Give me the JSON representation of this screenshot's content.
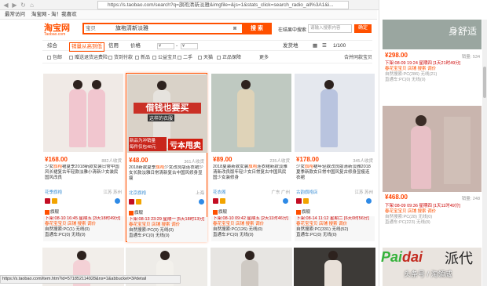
{
  "browser": {
    "url": "https://s.taobao.com/search?q=旗袍清新淡雅&imgfile=&js=1&stats_click=search_radio_all%3A1&i...",
    "bookmarks": [
      "最常访问",
      "淘宝网 - 淘！我喜欢"
    ]
  },
  "header": {
    "logo": "淘宝网",
    "logo_sub": "Taobao.com",
    "scope": "宝贝",
    "query": "旗袍清新淡雅",
    "search_button": "搜 索",
    "sub_label": "在结果中搜索",
    "sub_placeholder": "请输入搜索内容",
    "sub_button": "确定"
  },
  "sortbar": {
    "items": [
      "综合",
      "销量从高到低",
      "信用",
      "价格"
    ],
    "price_from": "¥",
    "price_to": "¥",
    "ship": "发货地",
    "view_grid": "▦",
    "view_list": "☰",
    "page": "1/100"
  },
  "filterbar": {
    "items": [
      "包邮",
      "赠送退货运费险",
      "货到付款",
      "新品",
      "公益宝贝",
      "二手",
      "天猫",
      "正品保障"
    ],
    "more": "更多",
    "combine": "合并同款宝贝"
  },
  "cards": [
    {
      "price": "¥168.00",
      "sold": "882人收货",
      "title_pre": "少女",
      "title_hl": "旗袍",
      "title_rest": "裙夏季2018新款女装日常中国风长裙复古年轻款淡雅小清新少女装民国风改良",
      "shop": "花季旗袍",
      "loc": "江苏 苏州",
      "tm": "旗舰",
      "ext_time": "下架:08-10 16:45 星期五 [3天18时49分]",
      "ext_shop": "春花宝宝贝 店铺 搜索 调价",
      "ext_stat": "自然搜索:PC(1) 无线(0)",
      "ext_car": "直通车:PC(0) 无线(0)",
      "img_bg": "#f0eae6",
      "dress": "#f1c6cf",
      "highlight": false
    },
    {
      "price": "¥48.00",
      "sold": "361人收货",
      "title_pre": "2018新款夏季",
      "title_hl": "旗袍",
      "title_rest": "少女改良版连衣裙少女长款淡雅日常清新复古中国风修身显瘦",
      "shop": "北京旗袍",
      "loc": "上海",
      "tm": "旗舰",
      "ext_time": "下架:08-13 23:29 星期一 [5天18时13分]",
      "ext_shop": "春花宝宝贝 店铺 搜索 调价",
      "ext_stat": "自然搜索:PC(0) 无线(0)",
      "ext_car": "直通车:PC(0) 无线(0)",
      "img_bg": "#d9d2c8",
      "dress": "#e6e3de",
      "highlight": true,
      "promo1": "借钱也要买",
      "promo2": "这样的衣服",
      "promo3": "新品为冲销量",
      "promo4": "每件仅包48元",
      "promo5": "亏本甩卖"
    },
    {
      "price": "¥89.00",
      "sold": "235人收货",
      "title_pre": "2018夏装新款女装",
      "title_hl": "旗袍",
      "title_rest": "连衣裙新款淡雅清新改良版年轻少女日常复古中国风民国少女装修身",
      "shop": "花衣阁",
      "loc": "广东 广州",
      "tm": "旗舰",
      "ext_time": "下架:08-10 09:42 星期五 [2天11时46分]",
      "ext_shop": "春花宝宝贝 店铺 搜索 调价",
      "ext_stat": "自然搜索:PC(126) 无线(0)",
      "ext_car": "直通车:PC(0) 无线(0)",
      "img_bg": "#bfc9c1",
      "dress": "#dfd3b8",
      "highlight": false
    },
    {
      "price": "¥178.00",
      "sold": "345人收货",
      "title_pre": "少女",
      "title_hl": "旗袍",
      "title_rest": "裙年轻款改良版清新淡雅2018夏季新款女日常中国风复古修身显瘦连衣裙",
      "shop": "古韵旗袍店",
      "loc": "江苏 苏州",
      "tm": "旗舰",
      "ext_time": "下架:08-14 11:12 星期二 [6天0时56分]",
      "ext_shop": "春花宝宝贝 店铺 搜索 调价",
      "ext_stat": "自然搜索:PC(331) 无线(52)",
      "ext_car": "直通车:PC(0) 无线(0)",
      "img_bg": "#e5e8ee",
      "dress": "#b9c4df",
      "highlight": false
    }
  ],
  "right_col": [
    {
      "price": "¥298.00",
      "sold": "销量: 534",
      "ext_time": "下架:08-09 19:24 星期四 [1天21时49分]",
      "ext_shop": "春花宝宝贝 店铺 搜索 调价",
      "ext_stat": "自然搜索:PC(286) 无线(21)",
      "ext_car": "直通车:PC(0) 无线(0)",
      "img_bg": "#9aa6a0",
      "banner": "身舒适"
    },
    {
      "price": "¥468.00",
      "sold": "销量: 248",
      "ext_time": "下架:08-09 09:36 星期四 [1天11时49分]",
      "ext_shop": "春花宝宝贝 店铺 搜索 调价",
      "ext_stat": "自然搜索:PC(28) 无线(0)",
      "ext_car": "直通车:PC(223) 无线(8)",
      "img_bg": "#c9b5ae",
      "dress": "#e8c0c6"
    }
  ],
  "bottom_row": [
    {
      "bg": "#f2eeea",
      "dress": "#f4d1d6"
    },
    {
      "bg": "#eeece8",
      "dress": "#f3f1ec"
    },
    {
      "bg": "#e7e5e2",
      "dress": "#cfcac4"
    },
    {
      "bg": "#3d3a37",
      "dress": "#e8e0d8"
    }
  ],
  "status_url": "https://s.taobao.com/item.htm?id=571852114928&ns=1&abbucket=3#detail",
  "watermark": {
    "brand1": "Pai",
    "brand2": "dai",
    "brand_cn": "派代",
    "caption": "头条号 / 淘領威"
  },
  "colors": {
    "accent": "#ff5000",
    "price": "#ff4400"
  }
}
